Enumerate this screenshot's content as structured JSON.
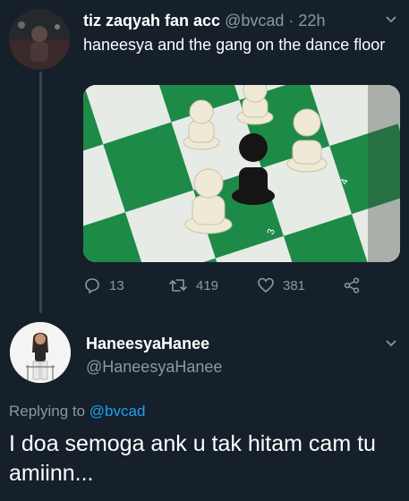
{
  "tweet1": {
    "name": "tiz zaqyah fan acc",
    "handle": "@bvcad",
    "separator": "·",
    "time": "22h",
    "text": "haneesya and the gang on the dance floor",
    "media": {
      "description": "chess pieces on a green and white board",
      "board_labels": [
        "3",
        "4"
      ]
    },
    "actions": {
      "replies": "13",
      "retweets": "419",
      "likes": "381"
    }
  },
  "tweet2": {
    "name": "HaneesyaHanee",
    "handle": "@HaneesyaHanee",
    "replying_to_label": "Replying to",
    "replying_to_handle": "@bvcad",
    "text": "I doa semoga ank u tak hitam cam tu amiinn..."
  },
  "icons": {
    "reply": "reply-icon",
    "retweet": "retweet-icon",
    "like": "heart-icon",
    "share": "share-icon",
    "menu": "chevron-down-icon"
  },
  "colors": {
    "background": "#15202b",
    "text": "#ffffff",
    "muted": "#8899a6",
    "link": "#1da1f2",
    "board_green": "#1e8a47"
  }
}
